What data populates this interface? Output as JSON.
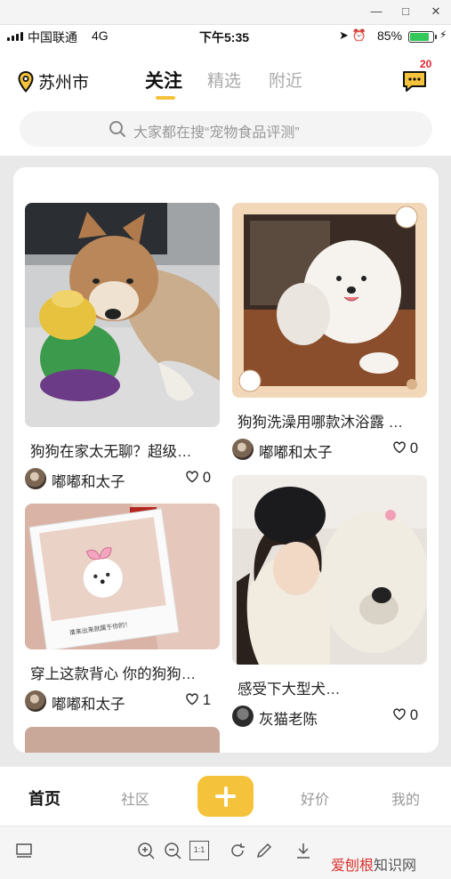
{
  "window_controls": {
    "minimize": "—",
    "maximize": "□",
    "close": "✕"
  },
  "status_bar": {
    "carrier": "中国联通",
    "network": "4G",
    "time": "下午5:35",
    "icons": "➤ ⏰",
    "battery_pct": "85%",
    "battery_level": 0.85,
    "charging_icon": "bolt-icon"
  },
  "header": {
    "city": "苏州市",
    "tabs": [
      {
        "label": "关注",
        "active": true
      },
      {
        "label": "精选",
        "active": false
      },
      {
        "label": "附近",
        "active": false
      }
    ],
    "message_badge": "20",
    "accent": "#f5c33b"
  },
  "search": {
    "placeholder": "大家都在搜“宠物食品评测”"
  },
  "feed": {
    "left": [
      {
        "caption": "狗狗在家太无聊？超级…",
        "author": "嘟嘟和太子",
        "likes": "0",
        "image": "shiba-inu-with-toy"
      },
      {
        "caption": "穿上这款背心 你的狗狗…",
        "author": "嘟嘟和太子",
        "likes": "1",
        "image": "polaroid-white-puppy-pink-bow",
        "photo_note": "谁来出来就属于你的！"
      }
    ],
    "right": [
      {
        "caption": "狗狗洗澡用哪款沐浴露 …",
        "author": "嘟嘟和太子",
        "likes": "0",
        "image": "samoyed-in-cat-frame"
      },
      {
        "caption": "感受下大型犬…",
        "author": "灰猫老陈",
        "likes": "0",
        "image": "girl-hugging-old-english-sheepdog"
      }
    ]
  },
  "bottom_nav": {
    "items": [
      {
        "label": "首页",
        "active": true
      },
      {
        "label": "社区",
        "active": false
      },
      {
        "label": "好价",
        "active": false
      },
      {
        "label": "我的",
        "active": false
      }
    ],
    "plus_icon": "plus-icon"
  },
  "viewer_toolbar": {
    "actual_size": "1:1",
    "watermark_brand": "爱刨根",
    "watermark_suffix": "知识网"
  }
}
